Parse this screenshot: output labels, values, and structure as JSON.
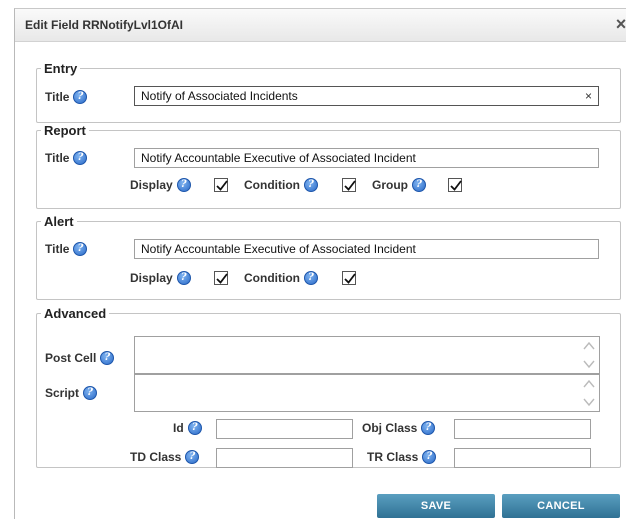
{
  "dialog": {
    "title": "Edit Field RRNotifyLvl1OfAI",
    "close_glyph": "×"
  },
  "entry": {
    "legend": "Entry",
    "title_label": "Title",
    "title_value": "Notify of Associated Incidents",
    "clear_glyph": "×"
  },
  "report": {
    "legend": "Report",
    "title_label": "Title",
    "title_value": "Notify Accountable Executive of Associated Incident",
    "display_label": "Display",
    "condition_label": "Condition",
    "group_label": "Group",
    "display_checked": true,
    "condition_checked": true,
    "group_checked": true
  },
  "alert": {
    "legend": "Alert",
    "title_label": "Title",
    "title_value": "Notify Accountable Executive of Associated Incident",
    "display_label": "Display",
    "condition_label": "Condition",
    "display_checked": true,
    "condition_checked": true
  },
  "advanced": {
    "legend": "Advanced",
    "post_cell_label": "Post Cell",
    "script_label": "Script",
    "id_label": "Id",
    "obj_class_label": "Obj Class",
    "td_class_label": "TD Class",
    "tr_class_label": "TR Class",
    "post_cell_value": "",
    "script_value": "",
    "id_value": "",
    "obj_class_value": "",
    "td_class_value": "",
    "tr_class_value": ""
  },
  "buttons": {
    "save": "SAVE",
    "cancel": "CANCEL"
  },
  "icons": {
    "help": "help-icon",
    "check": "checkmark-icon",
    "close": "close-icon"
  },
  "colors": {
    "help_icon": "#2a6ac8",
    "button": "#3a7fa3"
  }
}
